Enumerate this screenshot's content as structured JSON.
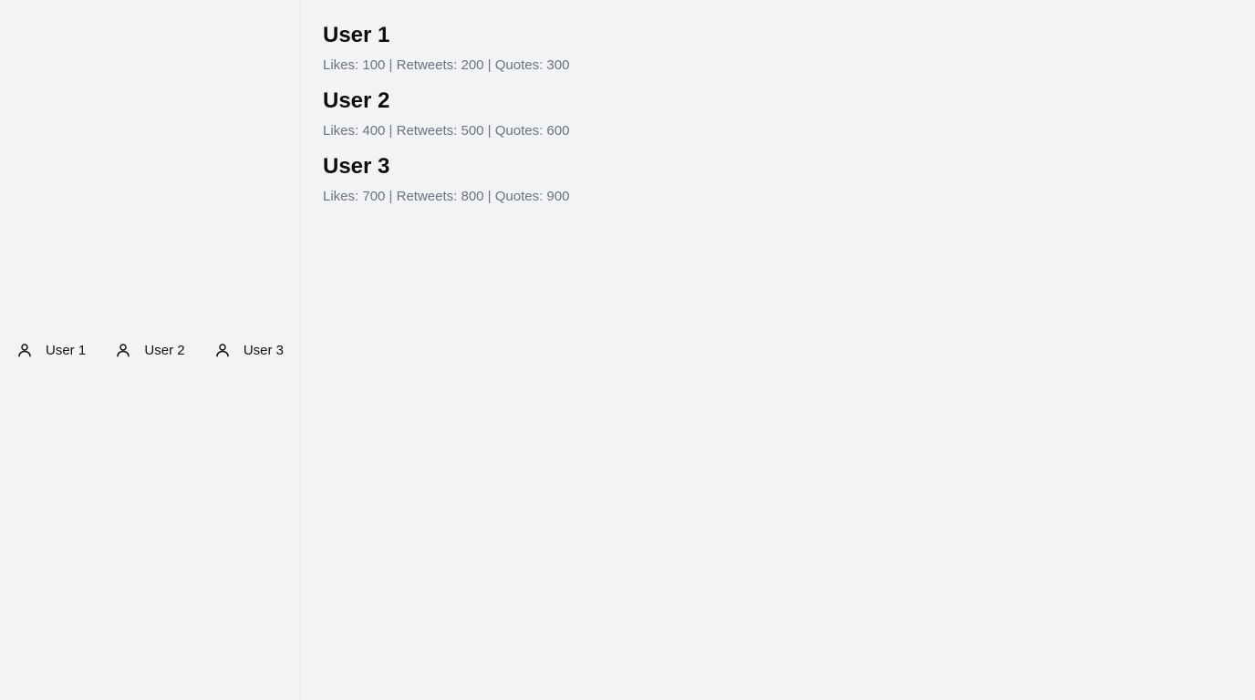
{
  "sidebar": {
    "items": [
      {
        "label": "User 1",
        "icon": "user-icon"
      },
      {
        "label": "User 2",
        "icon": "user-icon"
      },
      {
        "label": "User 3",
        "icon": "user-icon"
      }
    ]
  },
  "main": {
    "users": [
      {
        "name": "User 1",
        "stats": "Likes: 100 | Retweets: 200 | Quotes: 300"
      },
      {
        "name": "User 2",
        "stats": "Likes: 400 | Retweets: 500 | Quotes: 600"
      },
      {
        "name": "User 3",
        "stats": "Likes: 700 | Retweets: 800 | Quotes: 900"
      }
    ]
  },
  "colors": {
    "background": "#f2f3f5",
    "text_primary": "#0d0d0d",
    "text_secondary": "#6b7280",
    "divider": "#e2e4e8"
  }
}
